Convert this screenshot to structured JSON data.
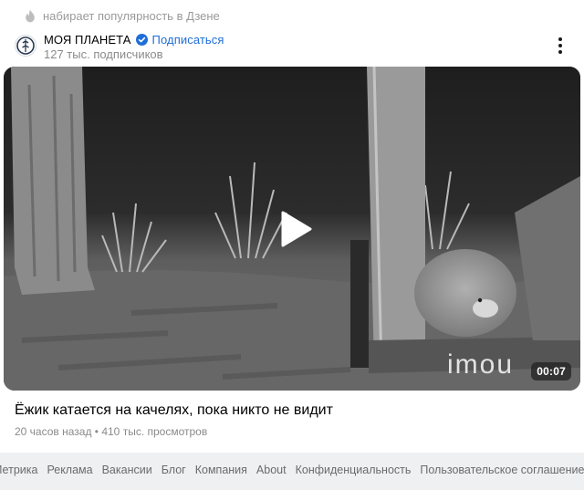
{
  "card": {
    "trending_text": "набирает популярность в Дзене",
    "channel": {
      "name": "МОЯ ПЛАНЕТА",
      "subscribe_label": "Подписаться",
      "subscribers": "127 тыс. подписчиков"
    },
    "video": {
      "watermark": "imou",
      "duration": "00:07"
    },
    "title": "Ёжик катается на качелях, пока никто не видит",
    "meta": "20 часов назад • 410 тыс. просмотров"
  },
  "footer": {
    "links": [
      "Метрика",
      "Реклама",
      "Вакансии",
      "Блог",
      "Компания",
      "About",
      "Конфиденциальность",
      "Пользовательское соглашение"
    ]
  },
  "colors": {
    "subscribe_link": "#1e6dd8",
    "verified_badge": "#1e6dd8",
    "footer_bg": "#eef0f2"
  }
}
